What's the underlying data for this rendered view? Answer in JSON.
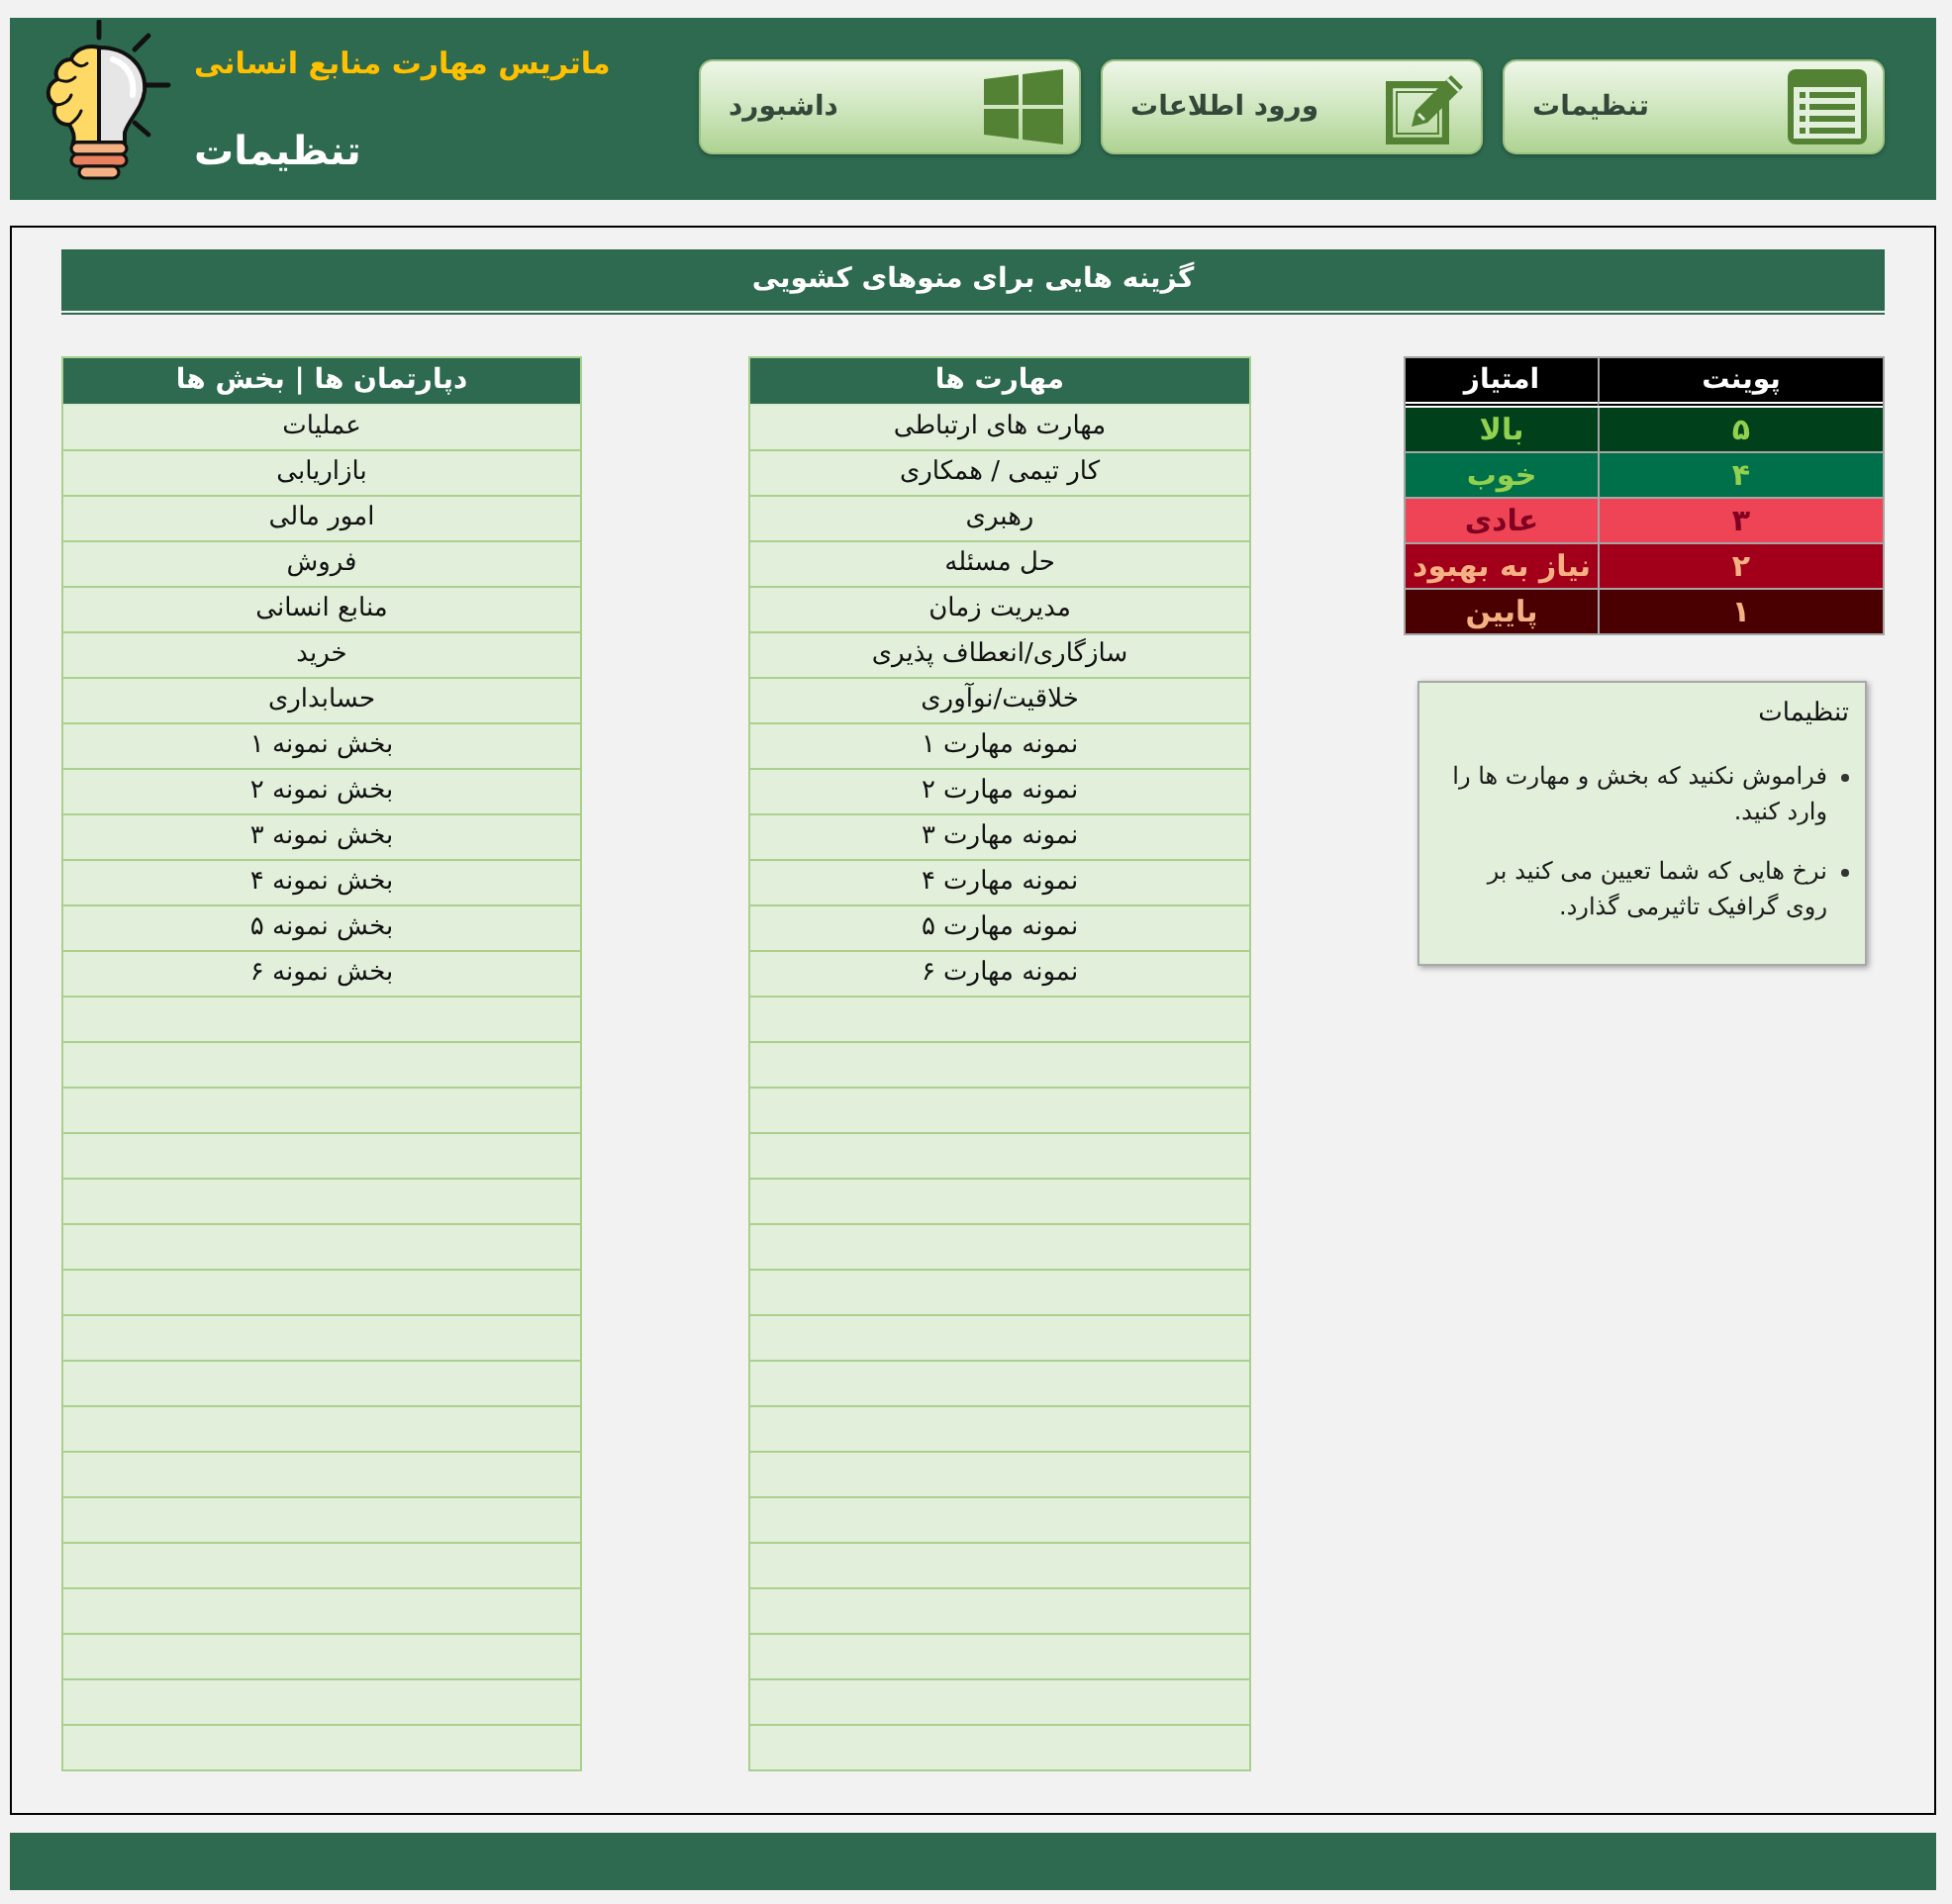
{
  "header": {
    "title": "ماتریس مهارت منابع انسانی",
    "subtitle": "تنظیمات",
    "nav_buttons": [
      {
        "label": "تنظیمات",
        "kind": "settings"
      },
      {
        "label": "ورود اطلاعات",
        "kind": "data_entry"
      },
      {
        "label": "داشبورد",
        "kind": "dashboard"
      }
    ]
  },
  "section_title": "گزینه هایی برای منوهای کشویی",
  "ratings": {
    "columns": [
      "پوینت",
      "امتیاز"
    ],
    "rows": [
      {
        "point": "۵",
        "label": "بالا",
        "color": "#00401a",
        "ink": {
          "color": "#92d050"
        }
      },
      {
        "point": "۴",
        "label": "خوب",
        "color": "#00704a",
        "ink": {
          "color": "#92d050"
        }
      },
      {
        "point": "۳",
        "label": "عادی",
        "color": "#ef4455",
        "ink": {
          "color": "#7f0020"
        }
      },
      {
        "point": "۲",
        "label": "نیاز به بهبود",
        "color": "#a2001a",
        "ink": {
          "color": "#f4b183"
        }
      },
      {
        "point": "۱",
        "label": "پایین",
        "color": "#4a0000",
        "ink": {
          "color": "#f4b183"
        }
      }
    ]
  },
  "notes": {
    "title": "تنظیمات",
    "items": [
      "فراموش نکنید که بخش و مهارت ها را وارد کنید.",
      "نرخ هایی که شما تعیین می کنید بر روی گرافیک تاثیرمی گذارد."
    ]
  },
  "skills": {
    "heading": "مهارت ها",
    "rows": [
      "مهارت های ارتباطی",
      "کار تیمی / همکاری",
      "رهبری",
      "حل مسئله",
      "مدیریت زمان",
      "سازگاری/انعطاف پذیری",
      "خلاقیت/نوآوری",
      "نمونه مهارت ۱",
      "نمونه مهارت ۲",
      "نمونه مهارت ۳",
      "نمونه مهارت ۴",
      "نمونه مهارت ۵",
      "نمونه مهارت ۶"
    ]
  },
  "departments": {
    "heading": "دپارتمان ها | بخش ها",
    "rows": [
      "عملیات",
      "بازاریابی",
      "امور مالی",
      "فروش",
      "منابع انسانی",
      "خرید",
      "حسابداری",
      "بخش نمونه ۱",
      "بخش نمونه ۲",
      "بخش نمونه ۳",
      "بخش نمونه ۴",
      "بخش نمونه ۵",
      "بخش نمونه ۶"
    ]
  }
}
